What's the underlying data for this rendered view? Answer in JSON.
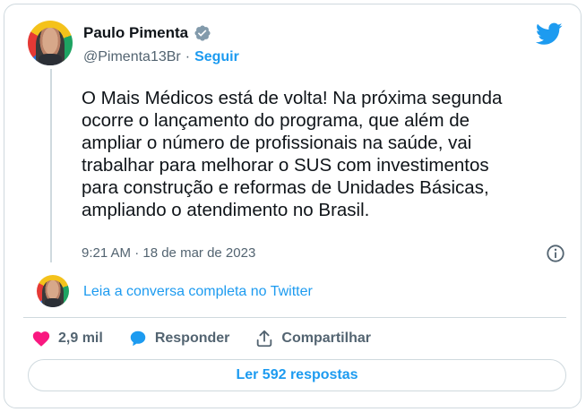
{
  "author": {
    "display_name": "Paulo Pimenta",
    "handle": "@Pimenta13Br",
    "separator": "·",
    "follow_label": "Seguir"
  },
  "tweet": {
    "text": "O Mais Médicos está de volta! Na próxima segunda\nocorre o lançamento do programa, que além de\nampliar o número de profissionais na saúde, vai\ntrabalhar para melhorar o SUS com investimentos\npara construção e reformas de Unidades Básicas,\nampliando o atendimento no Brasil.",
    "timestamp": "9:21 AM · 18 de mar de 2023"
  },
  "thread": {
    "link_label": "Leia a conversa completa no Twitter"
  },
  "actions": {
    "like_count": "2,9 mil",
    "reply_label": "Responder",
    "share_label": "Compartilhar"
  },
  "replies_button": {
    "label": "Ler 592 respostas"
  },
  "colors": {
    "accent": "#1d9bf0",
    "like": "#f91880",
    "text": "#0f1419",
    "muted": "#536471",
    "border": "#cfd9de"
  },
  "icons": [
    "verified-badge-icon",
    "twitter-bird-icon",
    "info-icon",
    "heart-icon",
    "reply-bubble-icon",
    "share-icon"
  ]
}
